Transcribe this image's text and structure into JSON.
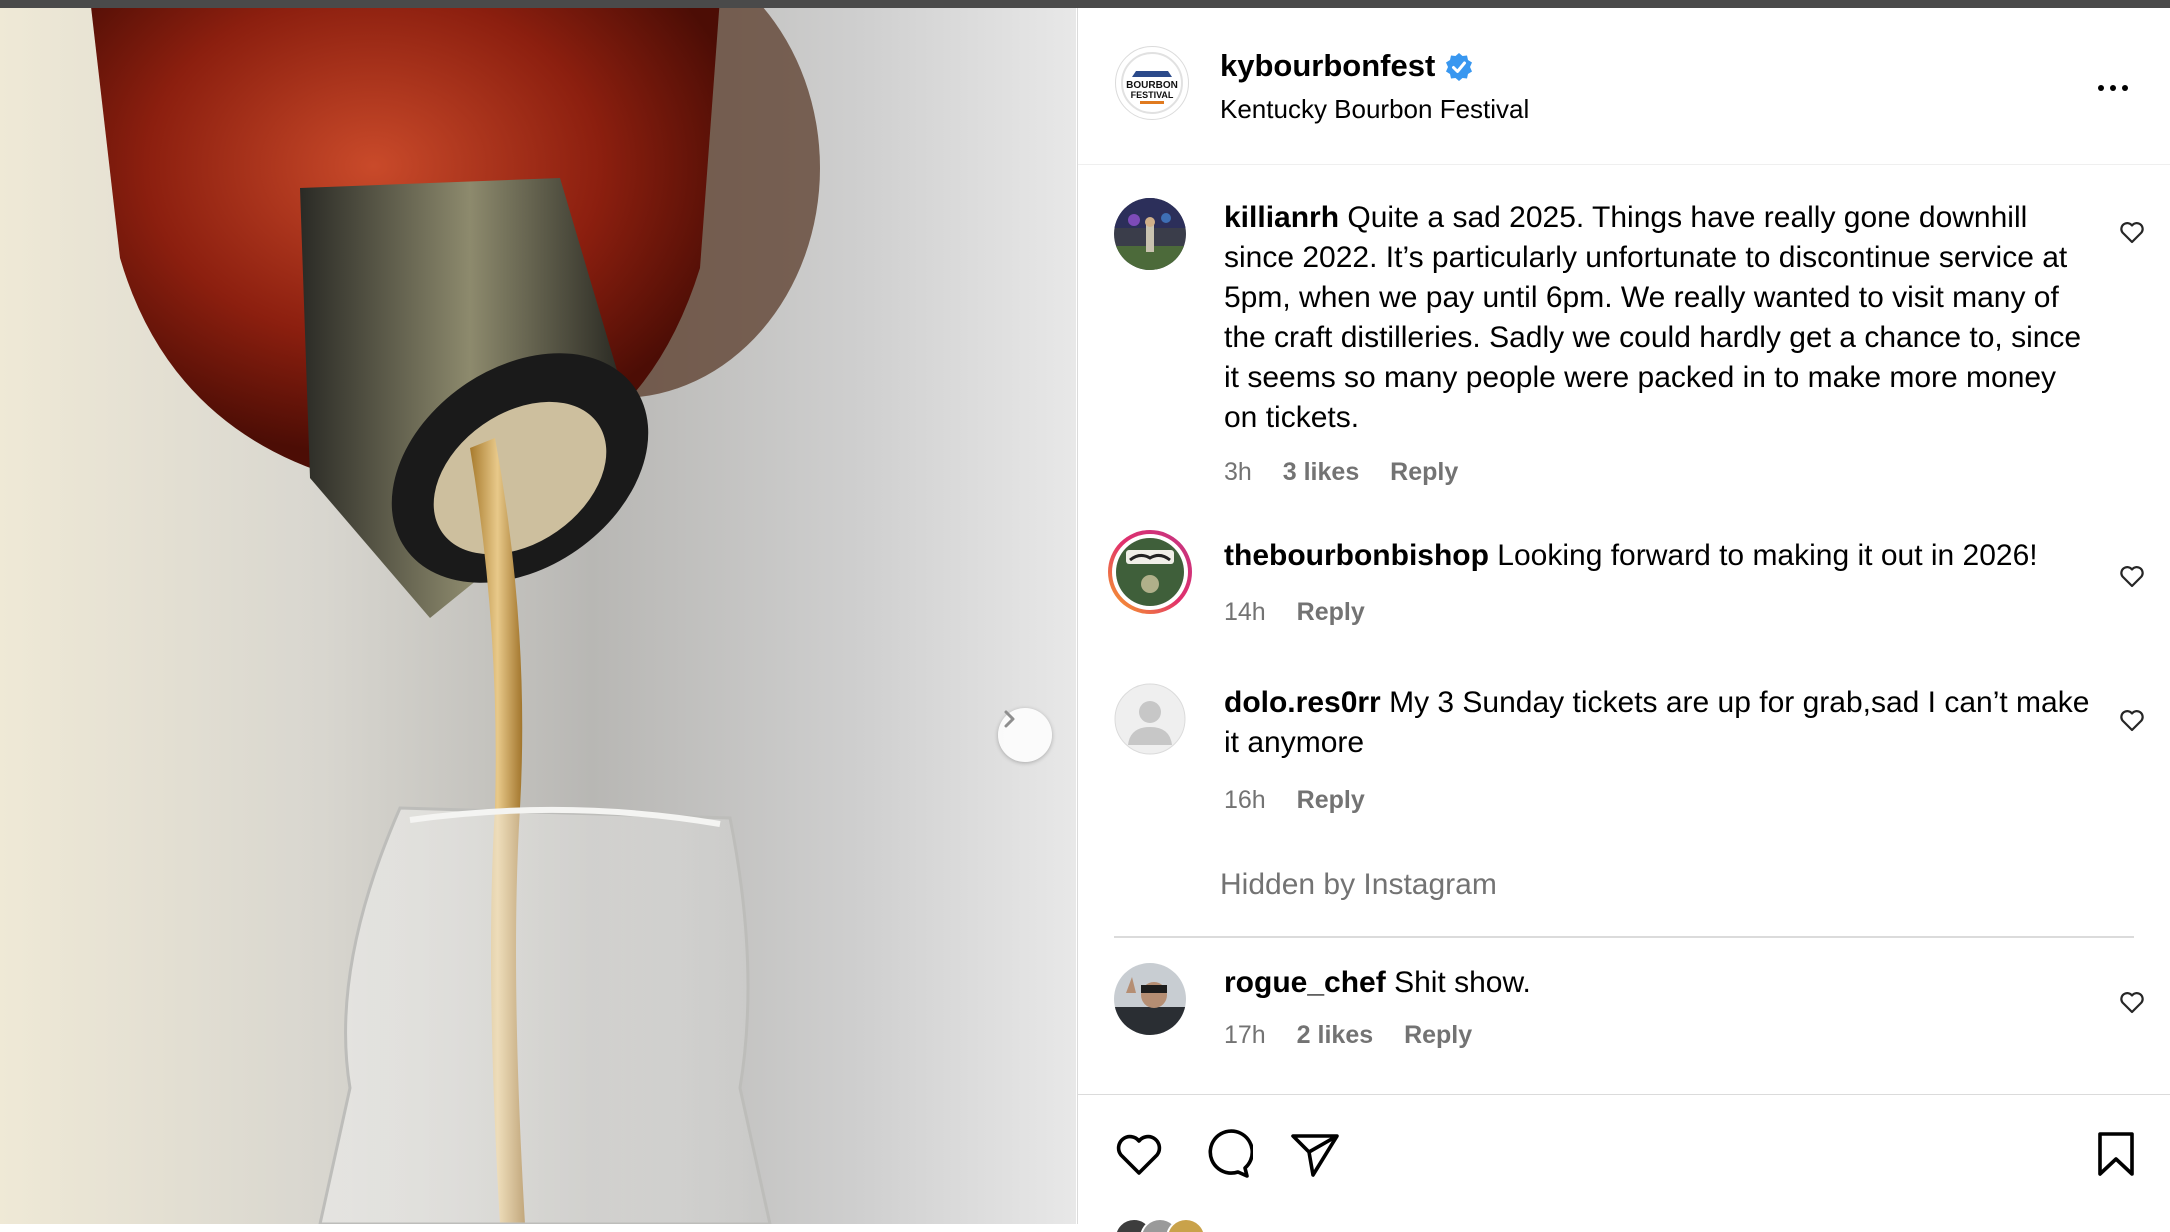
{
  "post": {
    "username": "kybourbonfest",
    "display_name": "Kentucky Bourbon Festival",
    "verified": true,
    "avatar_text": [
      "BOURBON",
      "FESTIVAL"
    ]
  },
  "icons": {
    "verified": "verified-badge-icon",
    "more": "more-options-icon",
    "next": "chevron-right-icon",
    "like": "heart-icon",
    "comment": "comment-bubble-icon",
    "share": "paper-plane-icon",
    "save": "bookmark-icon"
  },
  "comments": [
    {
      "username": "killianrh",
      "text": "Quite a sad 2025. Things have really gone downhill since 2022. It’s particularly unfortunate to discontinue service at 5pm, when we pay until 6pm. We really wanted to visit many of the craft distilleries. Sadly we could hardly get a chance to, since it seems so many people were packed in to make more money on tickets.",
      "time": "3h",
      "likes": "3 likes",
      "reply": "Reply"
    },
    {
      "username": "thebourbonbishop",
      "text": "Looking forward to making it out in 2026!",
      "time": "14h",
      "reply": "Reply"
    },
    {
      "username": "dolo.res0rr",
      "text": "My 3 Sunday tickets are up for grab,sad I can’t make it anymore",
      "time": "16h",
      "reply": "Reply"
    },
    {
      "username": "rogue_chef",
      "text": "Shit show.",
      "time": "17h",
      "likes": "2 likes",
      "reply": "Reply"
    }
  ],
  "hidden_note": "Hidden by Instagram",
  "colors": {
    "text_primary": "#000000",
    "text_secondary": "#737373",
    "verified_blue": "#3897f0",
    "story_ring_start": "#f9a825",
    "story_ring_end": "#c13584",
    "divider": "#dbdbdb"
  }
}
